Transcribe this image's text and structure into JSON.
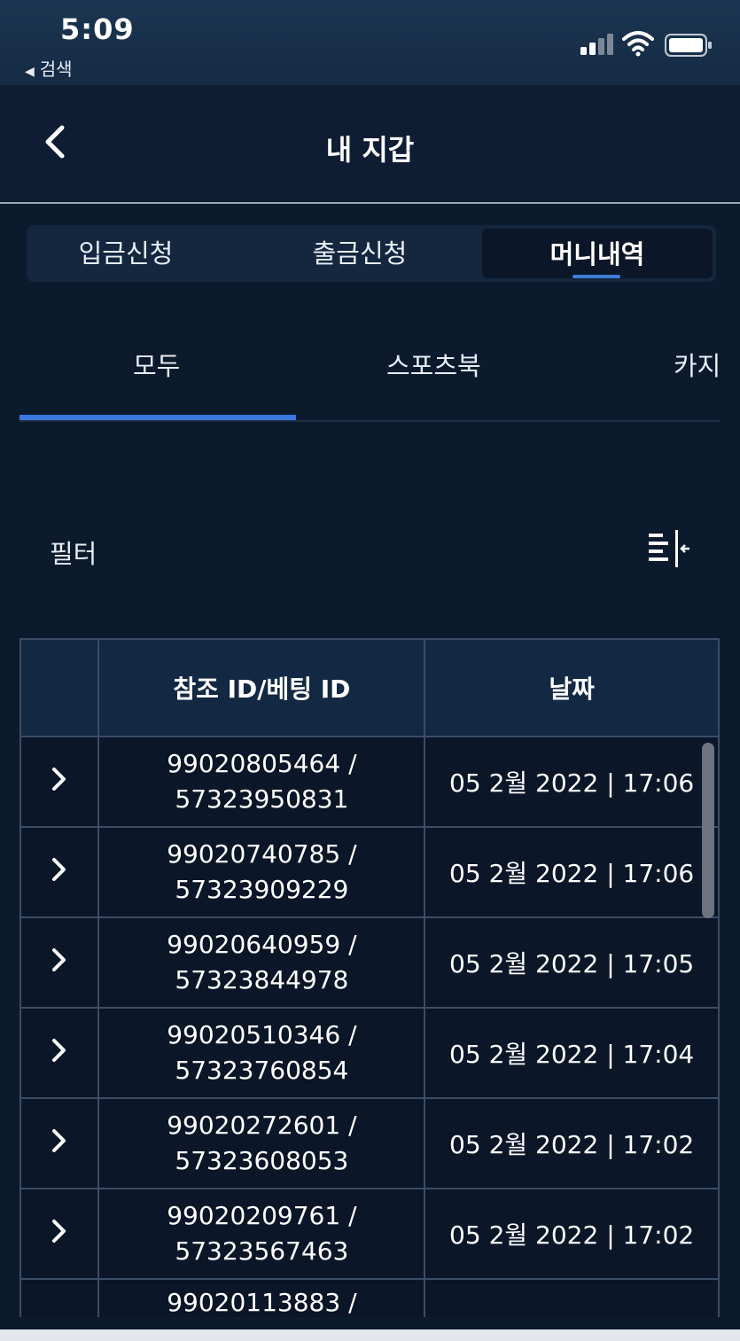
{
  "status_bar": {
    "time": "5:09",
    "back_label": "검색"
  },
  "header": {
    "title": "내 지갑"
  },
  "segments": [
    {
      "label": "입금신청"
    },
    {
      "label": "출금신청"
    },
    {
      "label": "머니내역"
    }
  ],
  "tabs": [
    {
      "label": "모두"
    },
    {
      "label": "스포츠북"
    },
    {
      "label": "카지"
    }
  ],
  "filter": {
    "label": "필터"
  },
  "table": {
    "headers": [
      "",
      "참조 ID/베팅 ID",
      "날짜"
    ],
    "rows": [
      {
        "ref_line1": "99020805464 /",
        "ref_line2": "57323950831",
        "date": "05 2월 2022 | 17:06"
      },
      {
        "ref_line1": "99020740785 /",
        "ref_line2": "57323909229",
        "date": "05 2월 2022 | 17:06"
      },
      {
        "ref_line1": "99020640959 /",
        "ref_line2": "57323844978",
        "date": "05 2월 2022 | 17:05"
      },
      {
        "ref_line1": "99020510346 /",
        "ref_line2": "57323760854",
        "date": "05 2월 2022 | 17:04"
      },
      {
        "ref_line1": "99020272601 /",
        "ref_line2": "57323608053",
        "date": "05 2월 2022 | 17:02"
      },
      {
        "ref_line1": "99020209761 /",
        "ref_line2": "57323567463",
        "date": "05 2월 2022 | 17:02"
      },
      {
        "ref_line1": "99020113883 /",
        "ref_line2": "",
        "date": ""
      }
    ]
  },
  "colors": {
    "background": "#0c1a2e",
    "accent": "#3a78e0",
    "header_cell": "#132843"
  },
  "icons": {
    "back": "chevron-left-icon",
    "expand": "chevron-right-icon",
    "filter": "filter-sort-icon"
  }
}
